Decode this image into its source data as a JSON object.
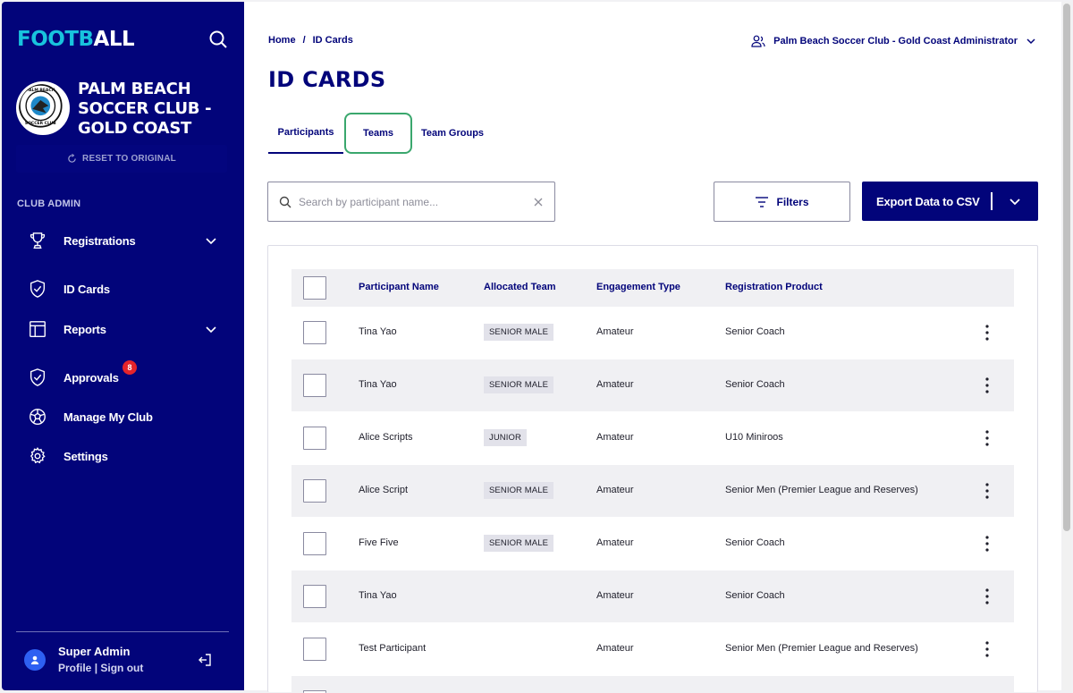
{
  "sidebar": {
    "brand_part1": "FOOTB",
    "brand_part2": "ALL",
    "club_name": "PALM BEACH SOCCER CLUB - GOLD COAST",
    "reset_label": "RESET TO ORIGINAL",
    "section_label": "CLUB ADMIN",
    "nav": [
      {
        "label": "Registrations",
        "icon": "trophy-icon"
      },
      {
        "label": "ID Cards",
        "icon": "shield-check-icon"
      },
      {
        "label": "Reports",
        "icon": "table-icon"
      },
      {
        "label": "Approvals",
        "icon": "shield-check-icon",
        "badge": "8"
      },
      {
        "label": "Manage My Club",
        "icon": "soccer-ball-icon"
      },
      {
        "label": "Settings",
        "icon": "gear-icon"
      }
    ],
    "user": {
      "name": "Super Admin",
      "profile": "Profile",
      "separator": "|",
      "signout": "Sign out"
    }
  },
  "header": {
    "breadcrumb": [
      "Home",
      "/",
      "ID Cards"
    ],
    "account": "Palm Beach Soccer Club - Gold Coast Administrator"
  },
  "page": {
    "title": "ID CARDS",
    "tabs": [
      "Participants",
      "Teams",
      "Team Groups"
    ],
    "active_tab": "Participants",
    "search_placeholder": "Search by participant name...",
    "filters_label": "Filters",
    "export_label": "Export Data to CSV"
  },
  "table": {
    "columns": [
      "Participant Name",
      "Allocated Team",
      "Engagement Type",
      "Registration Product"
    ],
    "rows": [
      {
        "name": "Tina Yao",
        "team": "SENIOR MALE",
        "type": "Amateur",
        "product": "Senior Coach"
      },
      {
        "name": "Tina Yao",
        "team": "SENIOR MALE",
        "type": "Amateur",
        "product": "Senior Coach"
      },
      {
        "name": "Alice Scripts",
        "team": "JUNIOR",
        "type": "Amateur",
        "product": "U10 Miniroos"
      },
      {
        "name": "Alice Script",
        "team": "SENIOR MALE",
        "type": "Amateur",
        "product": "Senior Men (Premier League and Reserves)"
      },
      {
        "name": "Five Five",
        "team": "SENIOR MALE",
        "type": "Amateur",
        "product": "Senior Coach"
      },
      {
        "name": "Tina Yao",
        "team": "",
        "type": "Amateur",
        "product": "Senior Coach"
      },
      {
        "name": "Test Participant",
        "team": "",
        "type": "Amateur",
        "product": "Senior Men (Premier League and Reserves)"
      }
    ]
  },
  "colors": {
    "navy": "#02047a",
    "accent_cyan": "#18c3dd",
    "badge_red": "#e5242b",
    "focus_green": "#3aa76d"
  }
}
